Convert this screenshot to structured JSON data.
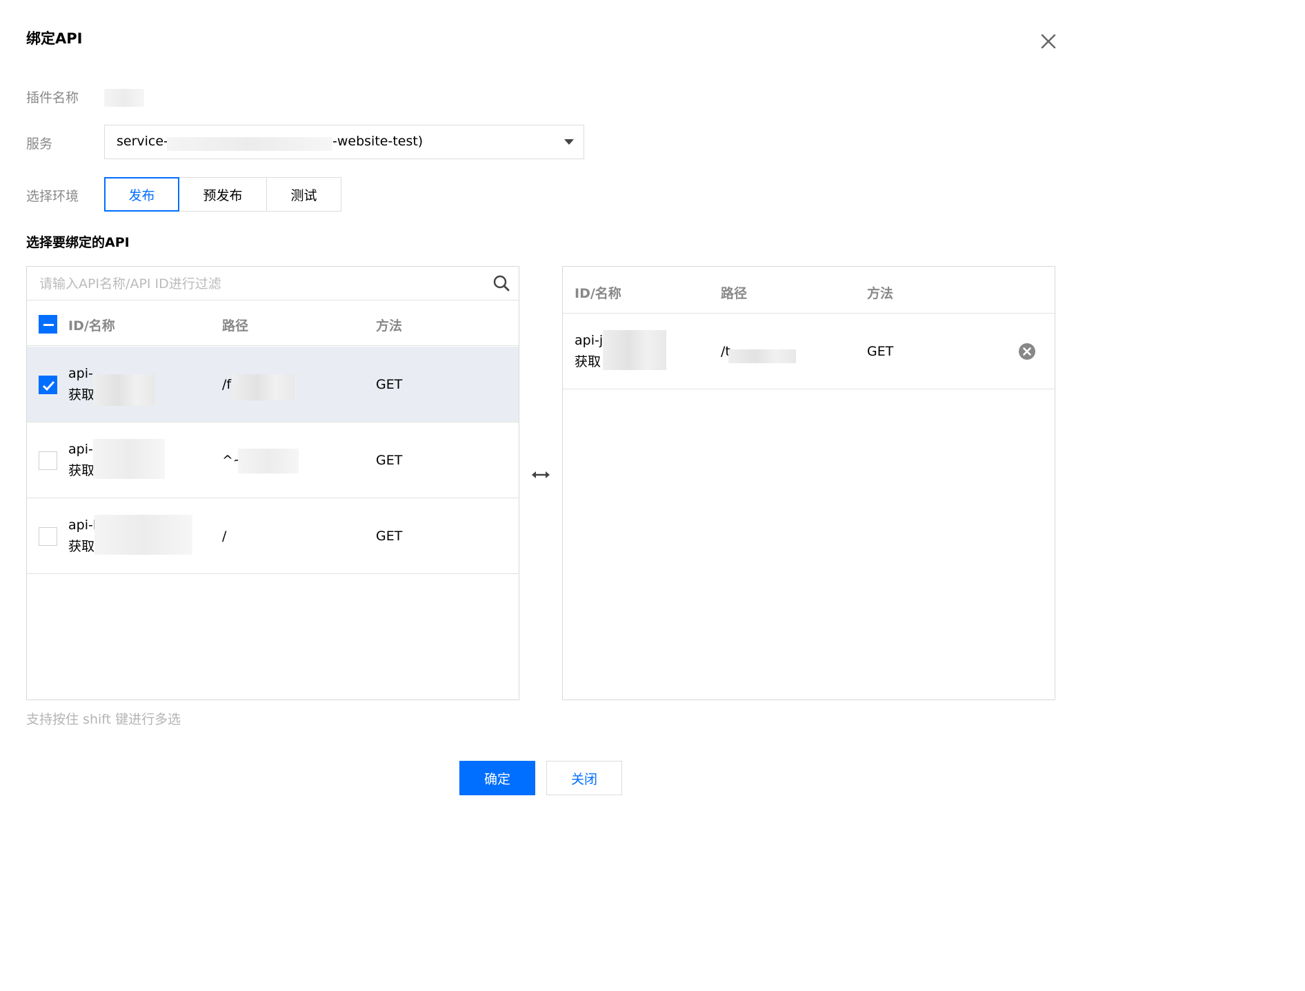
{
  "dialog": {
    "title": "绑定API"
  },
  "form": {
    "plugin_name_label": "插件名称",
    "service_label": "服务",
    "service_value_prefix": "service-",
    "service_value_suffix": "-website-test)",
    "env_label": "选择环境",
    "env_tabs": [
      {
        "label": "发布",
        "active": true
      },
      {
        "label": "预发布",
        "active": false
      },
      {
        "label": "测试",
        "active": false
      }
    ]
  },
  "section_title": "选择要绑定的API",
  "left_table": {
    "search_placeholder": "请输入API名称/API ID进行过滤",
    "columns": [
      "ID/名称",
      "路径",
      "方法"
    ],
    "header_checkbox_state": "indeterminate",
    "rows": [
      {
        "id": "api-",
        "name": "获取",
        "path": "/f",
        "method": "GET",
        "checked": true
      },
      {
        "id": "api-",
        "name": "获取",
        "path": "^~",
        "method": "GET",
        "checked": false
      },
      {
        "id": "api-l",
        "name": "获取",
        "path": "/",
        "method": "GET",
        "checked": false
      }
    ]
  },
  "right_table": {
    "columns": [
      "ID/名称",
      "路径",
      "方法"
    ],
    "rows": [
      {
        "id": "api-j",
        "name": "获取",
        "path": "/t",
        "method": "GET"
      }
    ]
  },
  "hint": "支持按住 shift 键进行多选",
  "buttons": {
    "confirm": "确定",
    "close": "关闭"
  },
  "colors": {
    "accent": "#006eff",
    "selected_row": "#e9edf3",
    "label_gray": "#888888"
  }
}
